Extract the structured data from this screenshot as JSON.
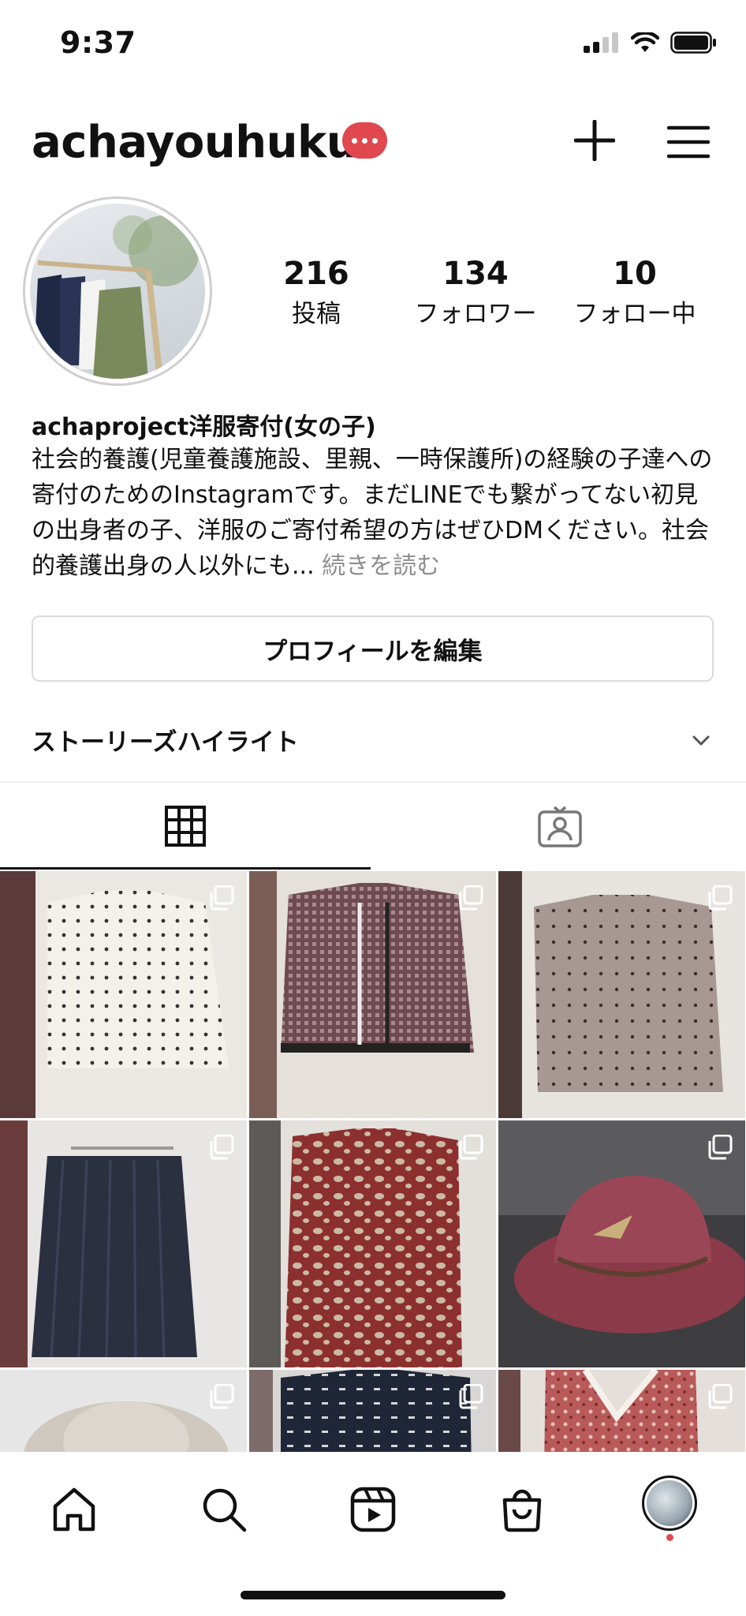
{
  "status_bar": {
    "time": "9:37",
    "signal": "signal-bars-icon",
    "wifi": "wifi-icon",
    "battery": "battery-icon"
  },
  "header": {
    "username": "achayouhuku",
    "notification_badge": "ellipsis-badge",
    "create_icon": "plus-icon",
    "menu_icon": "hamburger-menu-icon"
  },
  "profile": {
    "stats": [
      {
        "value": "216",
        "label": "投稿"
      },
      {
        "value": "134",
        "label": "フォロワー"
      },
      {
        "value": "10",
        "label": "フォロー中"
      }
    ],
    "display_name": "achaproject洋服寄付(女の子)",
    "bio": "社会的養護(児童養護施設、里親、一時保護所)の経験の子達への寄付のためのInstagramです。まだLINEでも繋がってない初見の出身者の子、洋服のご寄付希望の方はぜひDMください。社会的養護出身の人以外にも...",
    "bio_more": "続きを読む"
  },
  "edit_profile_label": "プロフィールを編集",
  "story_highlights": {
    "title": "ストーリーズハイライト",
    "icon": "chevron-down-icon"
  },
  "tabs": [
    {
      "name": "grid",
      "icon": "grid-icon",
      "active": true
    },
    {
      "name": "tagged",
      "icon": "tagged-person-icon",
      "active": false
    }
  ],
  "posts": [
    {
      "id": "post-1",
      "desc": "white-polka-dot-blouse",
      "multi": true
    },
    {
      "id": "post-2",
      "desc": "tweed-jacket",
      "multi": true
    },
    {
      "id": "post-3",
      "desc": "beige-dot-blouse",
      "multi": true
    },
    {
      "id": "post-4",
      "desc": "navy-pleated-skirt",
      "multi": true
    },
    {
      "id": "post-5",
      "desc": "red-leopard-coat",
      "multi": true
    },
    {
      "id": "post-6",
      "desc": "red-felt-hat",
      "multi": true
    },
    {
      "id": "post-7",
      "desc": "beige-hat",
      "multi": true
    },
    {
      "id": "post-8",
      "desc": "navy-print-blouse",
      "multi": true
    },
    {
      "id": "post-9",
      "desc": "red-floral-dress",
      "multi": true
    }
  ],
  "bottom_nav": [
    {
      "name": "home",
      "icon": "home-icon"
    },
    {
      "name": "search",
      "icon": "search-icon"
    },
    {
      "name": "reels",
      "icon": "reels-icon"
    },
    {
      "name": "shop",
      "icon": "shopping-bag-icon"
    },
    {
      "name": "profile",
      "icon": "profile-avatar-icon",
      "notification": true
    }
  ],
  "colors": {
    "accent_red": "#e0474e",
    "border": "#dbdbdb",
    "muted_text": "#8e8e8e"
  }
}
